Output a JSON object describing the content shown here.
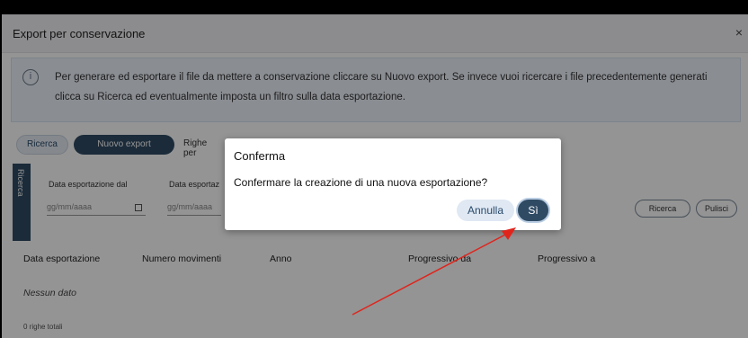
{
  "window": {
    "title": "Export per conservazione",
    "close_glyph": "×"
  },
  "info": {
    "icon": "info-icon",
    "text": "Per generare ed esportare il file da mettere a conservazione cliccare su Nuovo export. Se invece vuoi ricercare i file precedentemente generati clicca su Ricerca ed eventualmente imposta un filtro sulla data esportazione."
  },
  "toolbar": {
    "search_label": "Ricerca",
    "new_export_label": "Nuovo export",
    "rows_label": "Righe per"
  },
  "filters": {
    "side_tab_label": "Ricerca",
    "date_from_label": "Data esportazione dal",
    "date_from_placeholder": "gg/mm/aaaa",
    "date_to_label": "Data esportaz",
    "date_to_placeholder": "gg/mm/aaaa",
    "search_button": "Ricerca",
    "clear_button": "Pulisci"
  },
  "grid": {
    "columns": [
      "Data esportazione",
      "Numero movimenti",
      "Anno",
      "Progressivo da",
      "Progressivo a"
    ],
    "empty_text": "Nessun dato",
    "total_text": "0 righe totali"
  },
  "dialog": {
    "title": "Conferma",
    "message": "Confermare la creazione di una nuova esportazione?",
    "cancel_label": "Annulla",
    "confirm_label": "Sì"
  },
  "colors": {
    "accent": "#2f4b64",
    "annotation_arrow": "#e0241c"
  }
}
